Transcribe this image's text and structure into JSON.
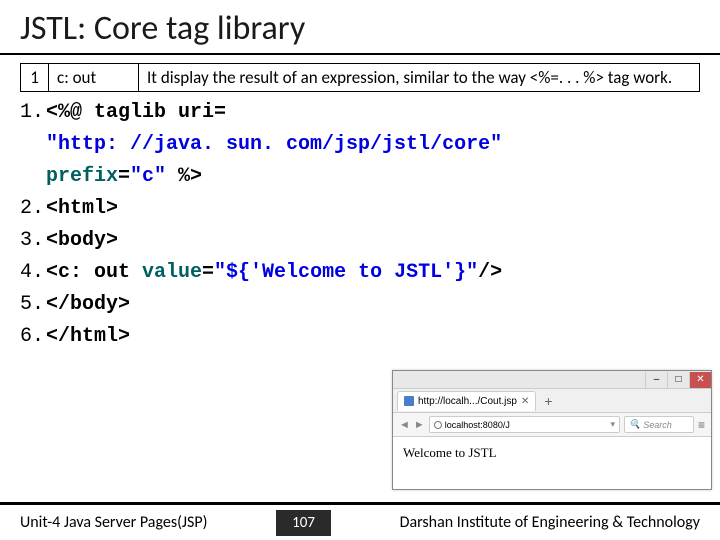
{
  "title": "JSTL: Core tag library",
  "tag_table": {
    "num": "1",
    "name": "c: out",
    "desc": "It display the result of an expression, similar to the way <%=. . . %> tag work."
  },
  "code": {
    "l1a": "<%@ taglib uri",
    "l1b": "=",
    "l1c": "\"http: //java. sun. com/jsp/jstl/core\"",
    "l1d": "prefix",
    "l1e": "=",
    "l1f": "\"c\"",
    "l1g": " %>",
    "l2": "<html>",
    "l3": "<body>",
    "l4a": "<c: out ",
    "l4b": "value",
    "l4c": "=",
    "l4d": "\"${'Welcome to JSTL'}\"",
    "l4e": "/>",
    "l5": "</body>",
    "l6": "</html>"
  },
  "browser": {
    "tab_title": "http://localh.../Cout.jsp",
    "url": "localhost:8080/J",
    "search_placeholder": "Search",
    "page_text": "Welcome to JSTL",
    "min": "–",
    "max": "□",
    "close": "✕",
    "tab_x": "✕",
    "plus": "+",
    "back": "◄",
    "fwd": "►",
    "dropdown": "▾",
    "menu": "≡"
  },
  "footer": {
    "left": "Unit-4 Java Server Pages(JSP)",
    "center": "107",
    "right": "Darshan Institute of Engineering & Technology"
  }
}
